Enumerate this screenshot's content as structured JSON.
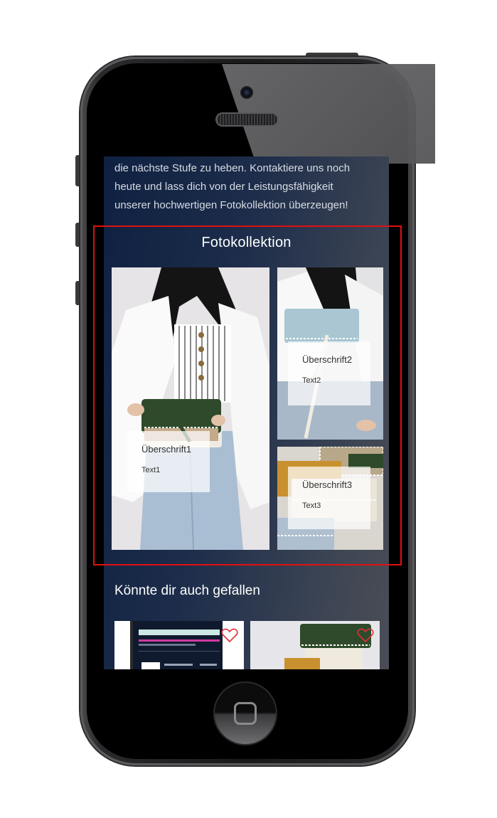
{
  "intro": {
    "lines": [
      "die nächste Stufe zu heben. Kontaktiere uns noch",
      "heute und lass dich von der Leistungsfähigkeit",
      "unserer hochwertigen Fotokollektion überzeugen!"
    ]
  },
  "gallery": {
    "title": "Fotokollektion",
    "tiles": [
      {
        "heading": "Überschrift1",
        "text": "Text1"
      },
      {
        "heading": "Überschrift2",
        "text": "Text2"
      },
      {
        "heading": "Überschrift3",
        "text": "Text3"
      }
    ]
  },
  "related": {
    "title": "Könnte dir auch gefallen"
  },
  "colors": {
    "screen_gradient_start": "#0f2141",
    "screen_gradient_end": "#4a4d55",
    "highlight_border": "#e01010",
    "heart": "#e0303a"
  },
  "icons": [
    "heart-icon",
    "home-button-icon",
    "camera-icon",
    "speaker-icon"
  ]
}
